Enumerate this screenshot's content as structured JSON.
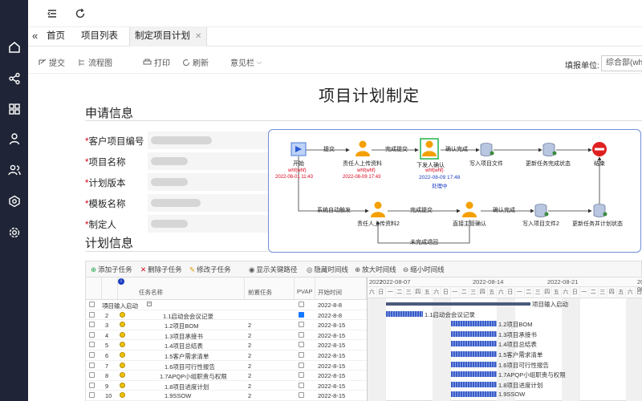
{
  "nav_icons": [
    "home-icon",
    "share-icon",
    "grid-icon",
    "user-icon",
    "users-icon",
    "settings-hex-icon",
    "gear-icon"
  ],
  "tabs": [
    {
      "label": "首页"
    },
    {
      "label": "项目列表"
    },
    {
      "label": "制定项目计划",
      "active": true
    }
  ],
  "toolbar": {
    "submit": "提交",
    "flowchart": "流程图",
    "print": "打印",
    "refresh": "刷新",
    "opinions": "意见栏",
    "dept_label": "填报单位:",
    "dept_value": "综合部(whf)"
  },
  "page_title": "项目计划制定",
  "apply_section": {
    "title": "申请信息",
    "fields": [
      {
        "label": "客户项目编号",
        "required": true
      },
      {
        "label": "项目名称",
        "required": true
      },
      {
        "label": "计划版本",
        "required": true
      },
      {
        "label": "模板名称",
        "required": true
      },
      {
        "label": "制定人",
        "required": true
      }
    ]
  },
  "flow": {
    "nodes": [
      "开始",
      "责任人上传资料",
      "下发人确认",
      "写入项目文件",
      "更新任务完成状态",
      "结束",
      "责任人上传资料2",
      "直接主管确认",
      "写入项目文件2",
      "更新任务并计划状态"
    ],
    "edges": [
      "提交",
      "完成提交",
      "确认完成",
      "确认完成",
      "系统自动触发",
      "完成提交",
      "确认完成",
      "未完成返回"
    ],
    "notes": [
      {
        "who": "whf(whf)",
        "when": "2022-08-01 11:43"
      },
      {
        "who": "whf(whf)",
        "when": "2022-08-09 17:43"
      },
      {
        "who": "whf(whf)",
        "when": "2022-08-09 17:48"
      }
    ],
    "back_label": "未完成退回",
    "pending_label": "处理中"
  },
  "plan_section": {
    "title": "计划信息"
  },
  "gantt": {
    "tools": [
      "添加子任务",
      "删除子任务",
      "修改子任务",
      "显示关键路径",
      "隐藏时间线",
      "放大时间线",
      "缩小时间线"
    ],
    "headers": {
      "name": "任务名称",
      "parent": "前置任务",
      "pvap": "PVAP",
      "start": "开始时间"
    },
    "weeks": [
      "2022-08-07",
      "2022-08-14",
      "2022-08-21",
      "2022-08-28"
    ],
    "weekdays": [
      "日",
      "一",
      "二",
      "三",
      "四",
      "五",
      "六"
    ],
    "rows": [
      {
        "no": "1",
        "name": "项目输入启动",
        "parent": "",
        "checked": false,
        "start": "2022-8-8",
        "summary": true
      },
      {
        "no": "2",
        "name": "1.1启动会会议记录",
        "parent": "",
        "checked": true,
        "start": "2022-8-8"
      },
      {
        "no": "3",
        "name": "1.2项目BOM",
        "parent": "2",
        "checked": false,
        "start": "2022-8-15"
      },
      {
        "no": "4",
        "name": "1.3项目承接书",
        "parent": "2",
        "checked": false,
        "start": "2022-8-15"
      },
      {
        "no": "5",
        "name": "1.4项目总结表",
        "parent": "2",
        "checked": false,
        "start": "2022-8-15"
      },
      {
        "no": "6",
        "name": "1.5客户需求清单",
        "parent": "2",
        "checked": false,
        "start": "2022-8-15"
      },
      {
        "no": "7",
        "name": "1.6项目可行性报告",
        "parent": "2",
        "checked": false,
        "start": "2022-8-15"
      },
      {
        "no": "8",
        "name": "1.7APQP小组职责与权限",
        "parent": "2",
        "checked": false,
        "start": "2022-8-15"
      },
      {
        "no": "9",
        "name": "1.8项目进度计划",
        "parent": "2",
        "checked": false,
        "start": "2022-8-15"
      },
      {
        "no": "10",
        "name": "1.9SSOW",
        "parent": "2",
        "checked": false,
        "start": "2022-8-15"
      }
    ],
    "bar_labels": [
      "项目输入启动",
      "1.1启动会会议记录",
      "1.2项目BOM",
      "1.3项目承接书",
      "1.4项目总结表",
      "1.5客户需求清单",
      "1.6项目可行性报告",
      "1.7APQP小组职责与权限",
      "1.8项目进度计划",
      "1.9SSOW"
    ]
  }
}
